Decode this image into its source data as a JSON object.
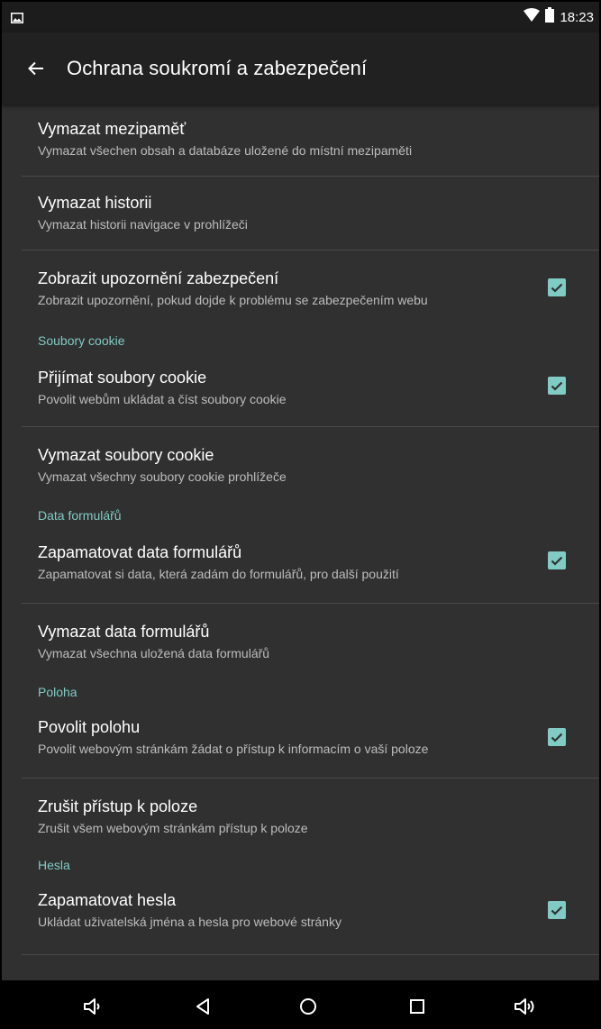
{
  "status_bar": {
    "time": "18:23",
    "icons": [
      "image-notification-icon",
      "wifi-icon",
      "battery-icon"
    ]
  },
  "app_bar": {
    "title": "Ochrana soukromí a zabezpečení",
    "back_icon": "arrow-back-icon"
  },
  "colors": {
    "accent": "#80cbc4",
    "background": "#303030",
    "app_bar": "#212121",
    "status_bar": "#1c1c1c"
  },
  "items": {
    "clear_cache": {
      "title": "Vymazat mezipaměť",
      "summary": "Vymazat všechen obsah a databáze uložené do místní mezipaměti"
    },
    "clear_history": {
      "title": "Vymazat historii",
      "summary": "Vymazat historii navigace v prohlížeči"
    },
    "security_warnings": {
      "title": "Zobrazit upozornění zabezpečení",
      "summary": "Zobrazit upozornění, pokud dojde k problému se zabezpečením webu",
      "checked": true
    },
    "cookies_category": "Soubory cookie",
    "accept_cookies": {
      "title": "Přijímat soubory cookie",
      "summary": "Povolit webům ukládat a číst soubory cookie",
      "checked": true
    },
    "clear_cookies": {
      "title": "Vymazat soubory cookie",
      "summary": "Vymazat všechny soubory cookie prohlížeče"
    },
    "form_data_category": "Data formulářů",
    "remember_form_data": {
      "title": "Zapamatovat data formulářů",
      "summary": "Zapamatovat si data, která zadám do formulářů, pro další použití",
      "checked": true
    },
    "clear_form_data": {
      "title": "Vymazat data formulářů",
      "summary": "Vymazat všechna uložená data formulářů"
    },
    "location_category": "Poloha",
    "enable_location": {
      "title": "Povolit polohu",
      "summary": "Povolit webovým stránkám žádat o přístup k informacím o vaší poloze",
      "checked": true
    },
    "clear_location": {
      "title": "Zrušit přístup k poloze",
      "summary": "Zrušit všem webovým stránkám přístup k poloze"
    },
    "passwords_category": "Hesla",
    "remember_passwords": {
      "title": "Zapamatovat hesla",
      "summary": "Ukládat uživatelská jména a hesla pro webové stránky",
      "checked": true
    }
  },
  "nav_bar": {
    "icons": [
      "volume-down-icon",
      "back-icon",
      "home-icon",
      "recents-icon",
      "volume-up-icon"
    ]
  }
}
